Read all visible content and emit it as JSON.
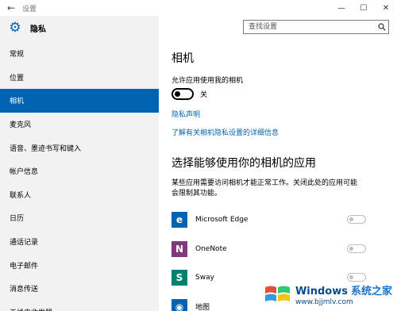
{
  "window": {
    "title": "设置"
  },
  "sidebar": {
    "header": "隐私",
    "items": [
      {
        "label": "常规"
      },
      {
        "label": "位置"
      },
      {
        "label": "相机"
      },
      {
        "label": "麦克风"
      },
      {
        "label": "语音、墨迹书写和键入"
      },
      {
        "label": "帐户信息"
      },
      {
        "label": "联系人"
      },
      {
        "label": "日历"
      },
      {
        "label": "通话记录"
      },
      {
        "label": "电子邮件"
      },
      {
        "label": "消息传送"
      },
      {
        "label": "无线电收发器"
      }
    ],
    "selected_index": 2
  },
  "search": {
    "placeholder": "查找设置"
  },
  "content": {
    "title": "相机",
    "allow_label": "允许应用使用我的相机",
    "toggle_state": "关",
    "privacy_link": "隐私声明",
    "learn_link": "了解有关相机隐私设置的详细信息",
    "section_title": "选择能够使用你的相机的应用",
    "section_desc": "某些应用需要访问相机才能正常工作。关闭此处的应用可能会限制其功能。",
    "apps": [
      {
        "name": "Microsoft Edge",
        "icon": "edge-icon",
        "color": "#0063b1",
        "glyph": "e"
      },
      {
        "name": "OneNote",
        "icon": "onenote-icon",
        "color": "#80397b",
        "glyph": "N"
      },
      {
        "name": "Sway",
        "icon": "sway-icon",
        "color": "#008272",
        "glyph": "S"
      },
      {
        "name": "地图",
        "icon": "maps-icon",
        "color": "#0063b1",
        "glyph": "◉"
      }
    ]
  },
  "watermark": {
    "line1": "Windows",
    "line1_alt": "系统之家",
    "url": "www.bjjmlv.com"
  }
}
